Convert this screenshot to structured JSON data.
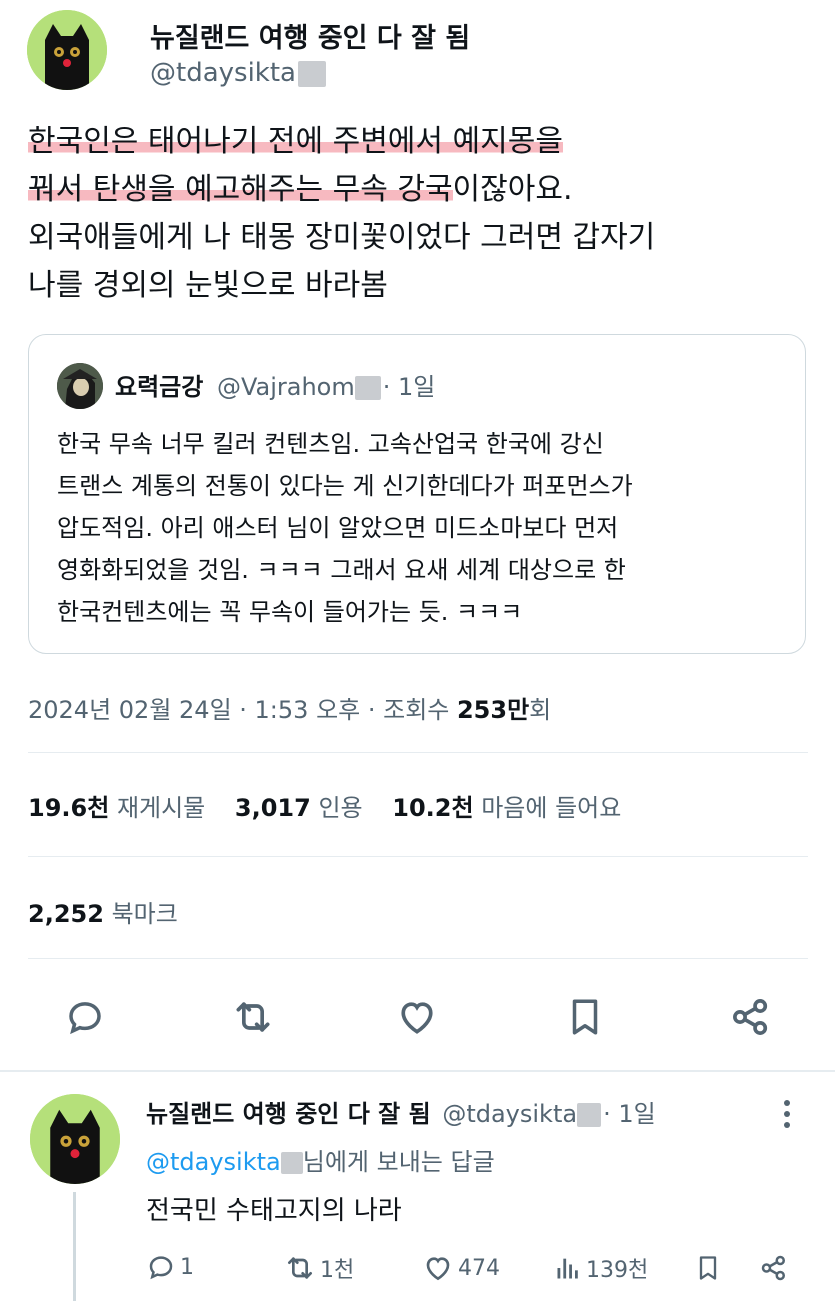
{
  "tweet": {
    "display_name": "뉴질랜드 여행 중인 다 잘 됨",
    "handle": "@tdaysikta",
    "body_line1_highlight": "한국인은 태어나기 전에 주변에서 예지몽을",
    "body_line2_highlight": "꿔서 탄생을 예고해주는 무속 강국",
    "body_line2_rest": "이잖아요.",
    "body_line3": "외국애들에게 나 태몽 장미꽃이었다 그러면 갑자기",
    "body_line4": "나를 경외의 눈빛으로 바라봄"
  },
  "quote": {
    "display_name": "요력금강",
    "handle": "@Vajrahom",
    "time": "· 1일",
    "lines": [
      "한국 무속 너무 킬러 컨텐츠임. 고속산업국 한국에 강신",
      "트랜스 계통의 전통이 있다는 게 신기한데다가 퍼포먼스가",
      "압도적임. 아리 애스터 님이 알았으면 미드소마보다 먼저",
      "영화화되었을 것임. ㅋㅋㅋ 그래서 요새 세계 대상으로 한",
      "한국컨텐츠에는 꼭 무속이 들어가는 듯. ㅋㅋㅋ"
    ]
  },
  "meta": {
    "date_time": "2024년 02월 24일 · 1:53 오후 · 조회수 ",
    "views_num": "253만",
    "views_suffix": "회"
  },
  "stats": {
    "retweets_num": "19.6천",
    "retweets_label": "재게시물",
    "quotes_num": "3,017",
    "quotes_label": "인용",
    "likes_num": "10.2천",
    "likes_label": "마음에 들어요",
    "bookmarks_num": "2,252",
    "bookmarks_label": "북마크"
  },
  "actions": {
    "icons": [
      "reply-icon",
      "retweet-icon",
      "like-icon",
      "bookmark-icon",
      "share-icon"
    ]
  },
  "reply": {
    "display_name": "뉴질랜드 여행 중인 다 잘 됨",
    "handle": "@tdaysikta",
    "time": "· 1일",
    "replying_handle": "@tdaysikta",
    "replying_suffix": "님에게 보내는 답글",
    "text": "전국민 수태고지의 나라",
    "reply_count": "1",
    "retweet_count": "1천",
    "like_count": "474",
    "view_count": "139천"
  },
  "colors": {
    "accent": "#1d9bf0",
    "muted": "#536471",
    "text": "#0f1419",
    "highlight": "#f0808c",
    "avatar_bg": "#b5e07a"
  }
}
